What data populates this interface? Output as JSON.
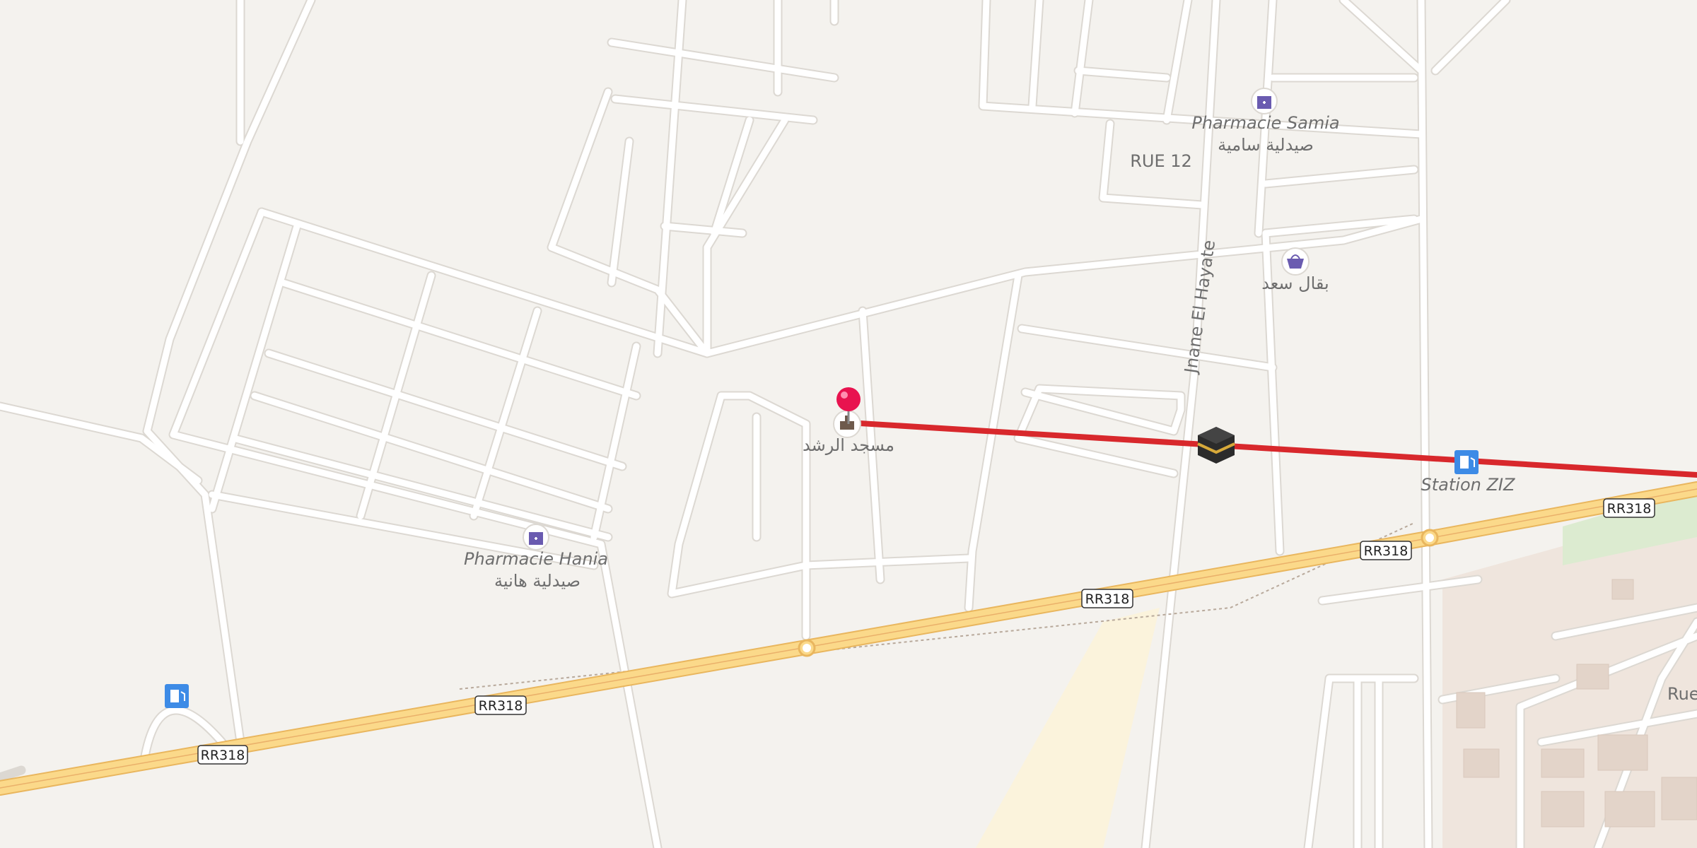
{
  "map": {
    "pharmacies": [
      {
        "name": "Pharmacie Samia",
        "name_ar": "صيدلية سامية"
      },
      {
        "name": "Pharmacie Hania",
        "name_ar": "صيدلية هانية"
      }
    ],
    "street_rue12": "RUE 12",
    "street_jnane": "Jnane El Hayate",
    "street_rue_partial": "Rue",
    "grocery_ar": "بقال سعد",
    "mosque_ar": "مسجد الرشد",
    "station_label": "Station ZIZ",
    "route_shields": [
      "RR318",
      "RR318",
      "RR318",
      "RR318",
      "RR318"
    ],
    "colors": {
      "background": "#f4f2ee",
      "road": "#ffffff",
      "road_casing": "#dcd8d2",
      "highway": "#fbd98a",
      "highway_casing": "#e9b65e",
      "direction_line": "#d8282c",
      "pin": "#e8134f",
      "poi_pharmacy": "#6a5bb0",
      "fuel_icon": "#3d8be6",
      "park": "#dcebd0",
      "building": "#e9dcd2"
    },
    "icons": [
      "pin-icon",
      "mosque-icon",
      "kaaba-icon",
      "pharmacy-icon",
      "shop-icon",
      "fuel-icon"
    ]
  }
}
